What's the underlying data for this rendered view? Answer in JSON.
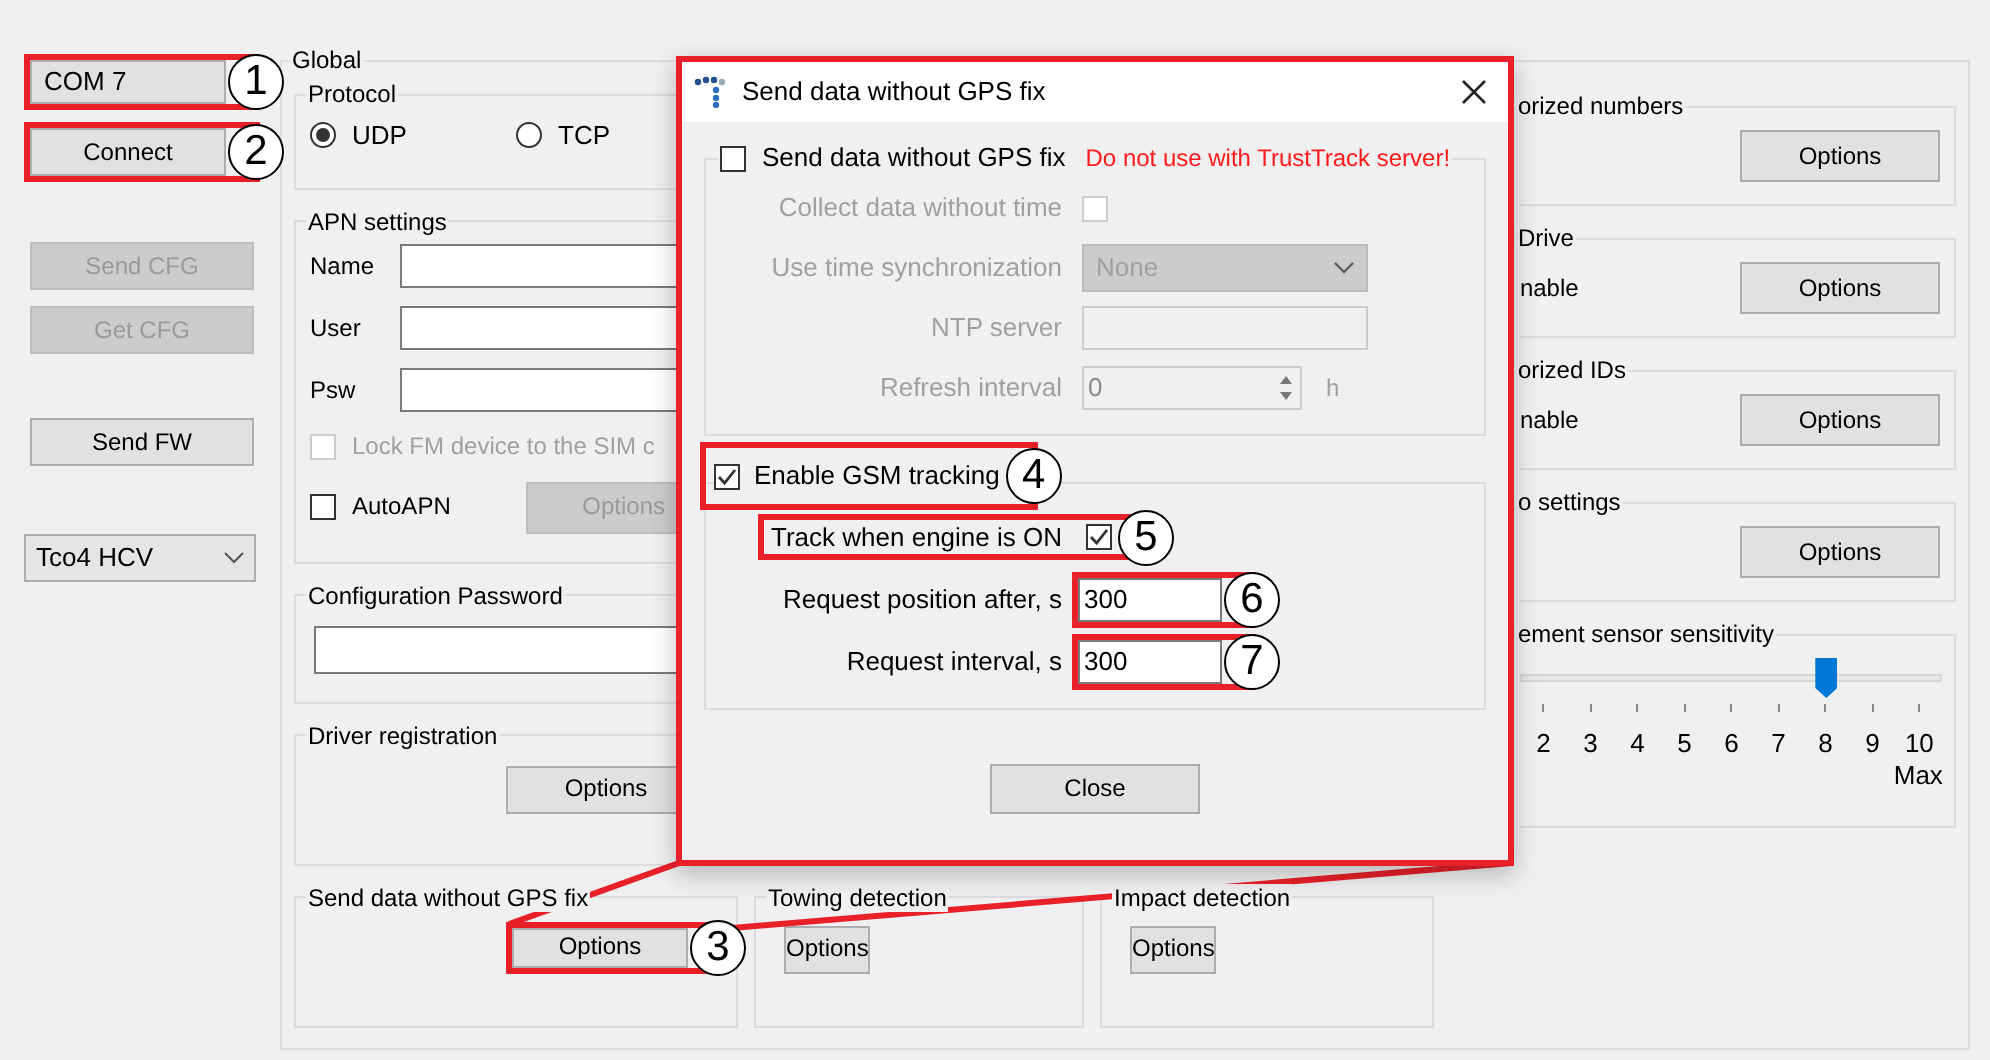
{
  "sidebar": {
    "port_field": {
      "value": "COM 7",
      "callout": "1"
    },
    "buttons": [
      {
        "label": "Connect",
        "disabled": false,
        "callout": "2"
      },
      {
        "label": "Send CFG",
        "disabled": true
      },
      {
        "label": "Get CFG",
        "disabled": true
      },
      {
        "label": "Send FW",
        "disabled": false
      }
    ],
    "device_select": {
      "value": "Tco4 HCV"
    }
  },
  "global": {
    "title": "Global",
    "protocol": {
      "title": "Protocol",
      "options": [
        {
          "label": "UDP",
          "selected": true
        },
        {
          "label": "TCP",
          "selected": false
        }
      ]
    },
    "apn": {
      "title": "APN settings",
      "fields": [
        {
          "label": "Name"
        },
        {
          "label": "User"
        },
        {
          "label": "Psw"
        }
      ],
      "lock": {
        "label": "Lock FM device to the SIM c",
        "checked": false,
        "disabled": true
      },
      "auto_apn": {
        "label": "AutoAPN",
        "checked": false
      },
      "options_button": {
        "label": "Options",
        "disabled": true
      }
    },
    "config_password": {
      "title": "Configuration Password"
    },
    "driver_registration": {
      "title": "Driver registration",
      "button": "Options"
    },
    "bottom_groups": [
      {
        "title": "Send data without GPS fix",
        "button": "Options",
        "callout": "3"
      },
      {
        "title": "Towing detection",
        "button": "Options"
      },
      {
        "title": "Impact detection",
        "button": "Options"
      }
    ],
    "right_groups": [
      {
        "title": "orized numbers",
        "button": "Options"
      },
      {
        "title": "Drive",
        "text": "nable",
        "button": "Options"
      },
      {
        "title": "orized IDs",
        "text": "nable",
        "button": "Options"
      },
      {
        "title": "o settings",
        "button": "Options"
      }
    ],
    "sensitivity": {
      "title": "ement sensor sensitivity",
      "level": 0.78,
      "ticks": [
        "2",
        "3",
        "4",
        "5",
        "6",
        "7",
        "8",
        "9",
        "10"
      ],
      "max_label": "Max"
    }
  },
  "dialog": {
    "title": "Send data without GPS fix",
    "groups": [
      {
        "toggle": {
          "label": "Send data without GPS fix",
          "checked": false
        },
        "warning": "Do not use with TrustTrack server!",
        "rows": [
          {
            "kind": "checkbox",
            "label": "Collect data without time",
            "checked": false,
            "disabled": true
          },
          {
            "kind": "select",
            "label": "Use time synchronization",
            "value": "None",
            "disabled": true
          },
          {
            "kind": "text",
            "label": "NTP server",
            "disabled": true
          },
          {
            "kind": "spin",
            "label": "Refresh interval",
            "value": "0",
            "unit": "h",
            "disabled": true
          }
        ]
      },
      {
        "toggle": {
          "label": "Enable GSM tracking",
          "checked": true,
          "callout": "4"
        },
        "rows": [
          {
            "kind": "checkbox",
            "label": "Track when engine is ON",
            "checked": true,
            "disabled": false,
            "callout": "5"
          },
          {
            "kind": "text",
            "label": "Request position after, s",
            "value": "300",
            "disabled": false,
            "callout": "6"
          },
          {
            "kind": "text",
            "label": "Request interval, s",
            "value": "300",
            "disabled": false,
            "callout": "7"
          }
        ]
      }
    ],
    "close_button": "Close"
  }
}
